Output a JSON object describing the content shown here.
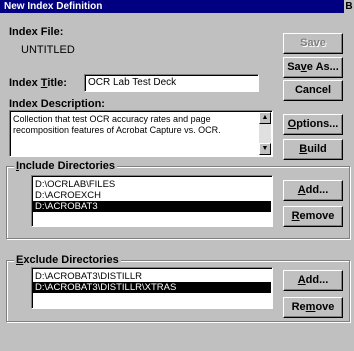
{
  "window": {
    "title": "New Index Definition",
    "close_glyph": "B"
  },
  "index_file": {
    "label": "Index File:",
    "value": "UNTITLED"
  },
  "index_title": {
    "label_pre": "Index ",
    "label_u": "T",
    "label_post": "itle:",
    "value": "OCR Lab Test Deck"
  },
  "index_description": {
    "label": "Index Description:",
    "text_line1": "Collection that test OCR accuracy rates and page",
    "text_line2": "recomposition features of Acrobat Capture vs. OCR."
  },
  "buttons": {
    "save": "Save",
    "save_as_pre": "Sa",
    "save_as_u": "v",
    "save_as_post": "e As...",
    "cancel": "Cancel",
    "options_u": "O",
    "options_post": "ptions...",
    "build_u": "B",
    "build_post": "uild"
  },
  "include": {
    "label_u": "I",
    "label_post": "nclude Directories",
    "items": [
      "D:\\OCRLAB\\FILES",
      "D:\\ACROEXCH",
      "D:\\ACROBAT3"
    ],
    "selected_index": 2,
    "add_u": "A",
    "add_post": "dd...",
    "remove_u": "R",
    "remove_post": "emove"
  },
  "exclude": {
    "label_u": "E",
    "label_post": "xclude Directories",
    "items": [
      "D:\\ACROBAT3\\DISTILLR",
      "D:\\ACROBAT3\\DISTILLR\\XTRAS"
    ],
    "selected_index": 1,
    "add_u": "A",
    "add_post": "dd...",
    "remove_pre": "Re",
    "remove_u": "m",
    "remove_post": "ove"
  }
}
